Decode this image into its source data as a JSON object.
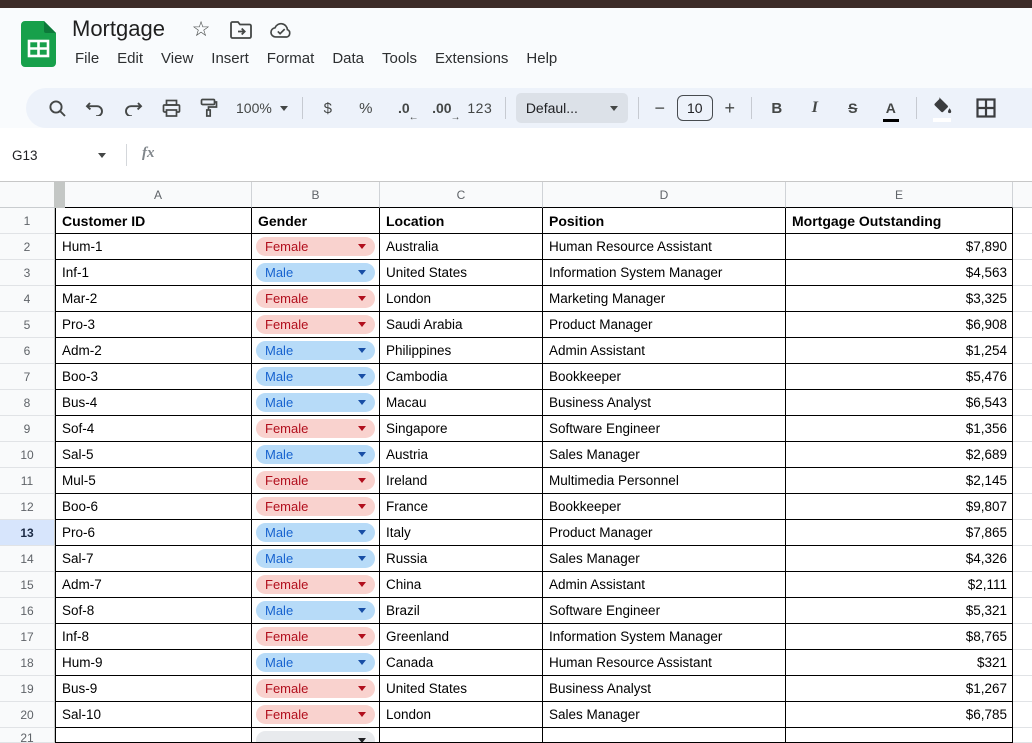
{
  "titlebar": {
    "title": "Mortgage",
    "icons": [
      "star-icon",
      "move-folder-icon",
      "cloud-saved-icon"
    ]
  },
  "menus": [
    "File",
    "Edit",
    "View",
    "Insert",
    "Format",
    "Data",
    "Tools",
    "Extensions",
    "Help"
  ],
  "toolbar": {
    "zoom": "100%",
    "currency_label": "$",
    "percent_label": "%",
    "decrease_decimal_label": ".0",
    "decrease_decimal_arrow": "←",
    "increase_decimal_label": ".00",
    "increase_decimal_arrow": "→",
    "number_format_label": "123",
    "font_name": "Defaul...",
    "font_size": "10",
    "bold_label": "B",
    "italic_label": "I",
    "strikethrough_label": "S",
    "text_color_label": "A",
    "icons": [
      "search-icon",
      "undo-icon",
      "redo-icon",
      "print-icon",
      "paint-format-icon",
      "fill-color-icon",
      "borders-icon"
    ]
  },
  "formula_bar": {
    "name_box": "G13",
    "fx_label": "fx",
    "input_value": ""
  },
  "grid": {
    "columns": [
      "A",
      "B",
      "C",
      "D",
      "E"
    ],
    "header_row_number": "1",
    "headers": [
      "Customer ID",
      "Gender",
      "Location",
      "Position",
      "Mortgage Outstanding"
    ],
    "selected_row": 13,
    "rows": [
      {
        "n": "2",
        "id": "Hum-1",
        "gender": "Female",
        "location": "Australia",
        "position": "Human Resource Assistant",
        "amount": "$7,890"
      },
      {
        "n": "3",
        "id": "Inf-1",
        "gender": "Male",
        "location": "United States",
        "position": "Information System Manager",
        "amount": "$4,563"
      },
      {
        "n": "4",
        "id": "Mar-2",
        "gender": "Female",
        "location": "London",
        "position": "Marketing Manager",
        "amount": "$3,325"
      },
      {
        "n": "5",
        "id": "Pro-3",
        "gender": "Female",
        "location": "Saudi Arabia",
        "position": "Product Manager",
        "amount": "$6,908"
      },
      {
        "n": "6",
        "id": "Adm-2",
        "gender": "Male",
        "location": "Philippines",
        "position": "Admin Assistant",
        "amount": "$1,254"
      },
      {
        "n": "7",
        "id": "Boo-3",
        "gender": "Male",
        "location": "Cambodia",
        "position": "Bookkeeper",
        "amount": "$5,476"
      },
      {
        "n": "8",
        "id": "Bus-4",
        "gender": "Male",
        "location": "Macau",
        "position": "Business Analyst",
        "amount": "$6,543"
      },
      {
        "n": "9",
        "id": "Sof-4",
        "gender": "Female",
        "location": "Singapore",
        "position": "Software Engineer",
        "amount": "$1,356"
      },
      {
        "n": "10",
        "id": "Sal-5",
        "gender": "Male",
        "location": "Austria",
        "position": "Sales Manager",
        "amount": "$2,689"
      },
      {
        "n": "11",
        "id": "Mul-5",
        "gender": "Female",
        "location": "Ireland",
        "position": "Multimedia Personnel",
        "amount": "$2,145"
      },
      {
        "n": "12",
        "id": "Boo-6",
        "gender": "Female",
        "location": "France",
        "position": "Bookkeeper",
        "amount": "$9,807"
      },
      {
        "n": "13",
        "id": "Pro-6",
        "gender": "Male",
        "location": "Italy",
        "position": "Product Manager",
        "amount": "$7,865"
      },
      {
        "n": "14",
        "id": "Sal-7",
        "gender": "Male",
        "location": "Russia",
        "position": "Sales Manager",
        "amount": "$4,326"
      },
      {
        "n": "15",
        "id": "Adm-7",
        "gender": "Female",
        "location": "China",
        "position": "Admin Assistant",
        "amount": "$2,111"
      },
      {
        "n": "16",
        "id": "Sof-8",
        "gender": "Male",
        "location": "Brazil",
        "position": "Software Engineer",
        "amount": "$5,321"
      },
      {
        "n": "17",
        "id": "Inf-8",
        "gender": "Female",
        "location": "Greenland",
        "position": "Information System Manager",
        "amount": "$8,765"
      },
      {
        "n": "18",
        "id": "Hum-9",
        "gender": "Male",
        "location": "Canada",
        "position": "Human Resource Assistant",
        "amount": "$321"
      },
      {
        "n": "19",
        "id": "Bus-9",
        "gender": "Female",
        "location": "United States",
        "position": "Business Analyst",
        "amount": "$1,267"
      },
      {
        "n": "20",
        "id": "Sal-10",
        "gender": "Female",
        "location": "London",
        "position": "Sales Manager",
        "amount": "$6,785"
      }
    ],
    "partial_row": {
      "n": "21",
      "gender": ""
    }
  },
  "colors": {
    "top_strip": "#3c2b28",
    "header_bg": "#f9fbfd",
    "toolbar_bg": "#edf2fa",
    "logo_green": "#17a04b",
    "female_chip_bg": "#f9d2ce",
    "female_chip_text": "#b10e1c",
    "male_chip_bg": "#b7dbf8",
    "male_chip_text": "#1763cf",
    "empty_chip_bg": "#e8eaed",
    "selected_row_bg": "#d7e5fc",
    "table_border": "#000000",
    "gridline": "#e1e3e6"
  }
}
